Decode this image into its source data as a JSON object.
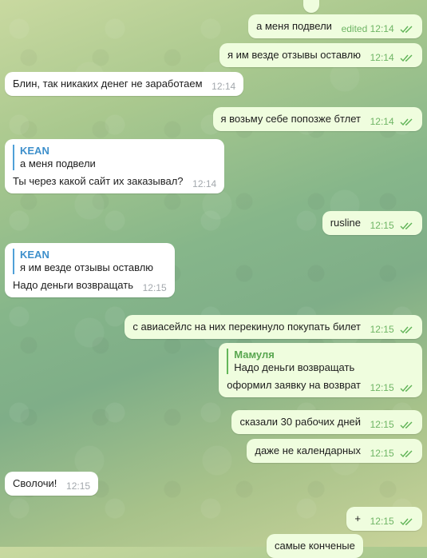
{
  "colors": {
    "outgoing_bubble": "#effdde",
    "incoming_bubble": "#ffffff",
    "outgoing_meta": "#6fb565",
    "incoming_meta": "#a3a8ad",
    "quote_name_incoming": "#3d8fcb",
    "quote_name_outgoing": "#58a64f"
  },
  "messages": [
    {
      "text": "а меня подвели",
      "edited": "edited",
      "time": "12:14"
    },
    {
      "text": "я им везде отзывы оставлю",
      "time": "12:14"
    },
    {
      "text": "Блин, так никаких денег не заработаем",
      "time": "12:14"
    },
    {
      "text": "я возьму себе попозже бтлет",
      "time": "12:14"
    },
    {
      "reply_name": "KEAN",
      "reply_text": "а меня подвели",
      "text": "Ты через какой сайт их заказывал?",
      "time": "12:14"
    },
    {
      "text": "rusline",
      "time": "12:15"
    },
    {
      "reply_name": "KEAN",
      "reply_text": "я им везде отзывы оставлю",
      "text": "Надо деньги возвращать",
      "time": "12:15"
    },
    {
      "text": "с авиасейлс на них перекинуло покупать билет",
      "time": "12:15"
    },
    {
      "reply_name": "Мамуля",
      "reply_text": "Надо деньги возвращать",
      "text": "оформил заявку на возврат",
      "time": "12:15"
    },
    {
      "text": "сказали 30 рабочих дней",
      "time": "12:15"
    },
    {
      "text": "даже не календарных",
      "time": "12:15"
    },
    {
      "text": "Сволочи!",
      "time": "12:15"
    },
    {
      "text": "+",
      "time": "12:15"
    },
    {
      "text": "самые конченые",
      "time": ""
    }
  ]
}
